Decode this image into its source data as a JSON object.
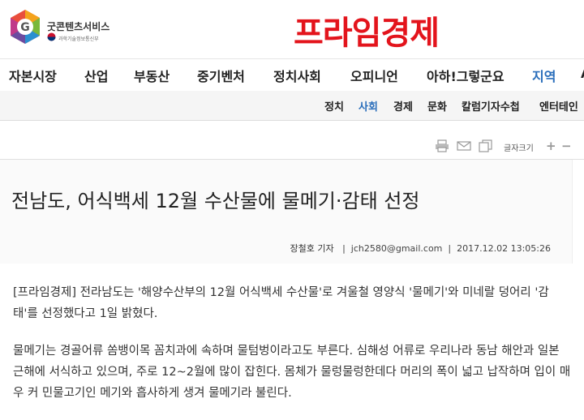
{
  "header": {
    "partner_logo_text": "굿콘텐츠서비스",
    "partner_logo_sub": "과학기술정보통신부",
    "brand": "프라임경제"
  },
  "main_nav": [
    {
      "label": "자본시장",
      "active": false
    },
    {
      "label": "산업",
      "active": false
    },
    {
      "label": "부동산",
      "active": false
    },
    {
      "label": "중기벤처",
      "active": false
    },
    {
      "label": "정치사회",
      "active": false
    },
    {
      "label": "오피니언",
      "active": false
    },
    {
      "label": "아하!그렇군요",
      "active": false
    },
    {
      "label": "지역",
      "active": true
    },
    {
      "label": "A",
      "active": false
    }
  ],
  "sub_nav": [
    {
      "label": "정치",
      "active": false
    },
    {
      "label": "사회",
      "active": true
    },
    {
      "label": "경제",
      "active": false
    },
    {
      "label": "문화",
      "active": false
    },
    {
      "label": "칼럼기자수첩",
      "active": false
    },
    {
      "label": "엔터테인",
      "active": false
    }
  ],
  "toolbar": {
    "icons": [
      "print-icon",
      "email-icon",
      "copy-icon"
    ],
    "font_size_label": "글자크기",
    "plus": "+",
    "minus": "−"
  },
  "article": {
    "headline": "전남도, 어식백세 12월 수산물에 물메기·감태 선정",
    "reporter": "장철호 기자",
    "email": "jch2580@gmail.com",
    "datetime": "2017.12.02 13:05:26",
    "paragraphs": [
      "[프라임경제] 전라남도는 '해양수산부의 12월 어식백세 수산물'로 겨울철 영양식 '물메기'와 미네랄 덩어리 '감태'를 선정했다고 1일 밝혔다.",
      "물메기는 경골어류 쏨뱅이목 꼼치과에 속하며 물텀벙이라고도 부른다. 심해성 어류로 우리나라 동남 해안과 일본 근해에 서식하고 있으며, 주로 12~2월에 많이 잡힌다. 몸체가 물렁물렁한데다 머리의 폭이 넓고 납작하며 입이 매우 커 민물고기인 메기와 흡사하게 생겨 물메기라 불린다."
    ]
  }
}
